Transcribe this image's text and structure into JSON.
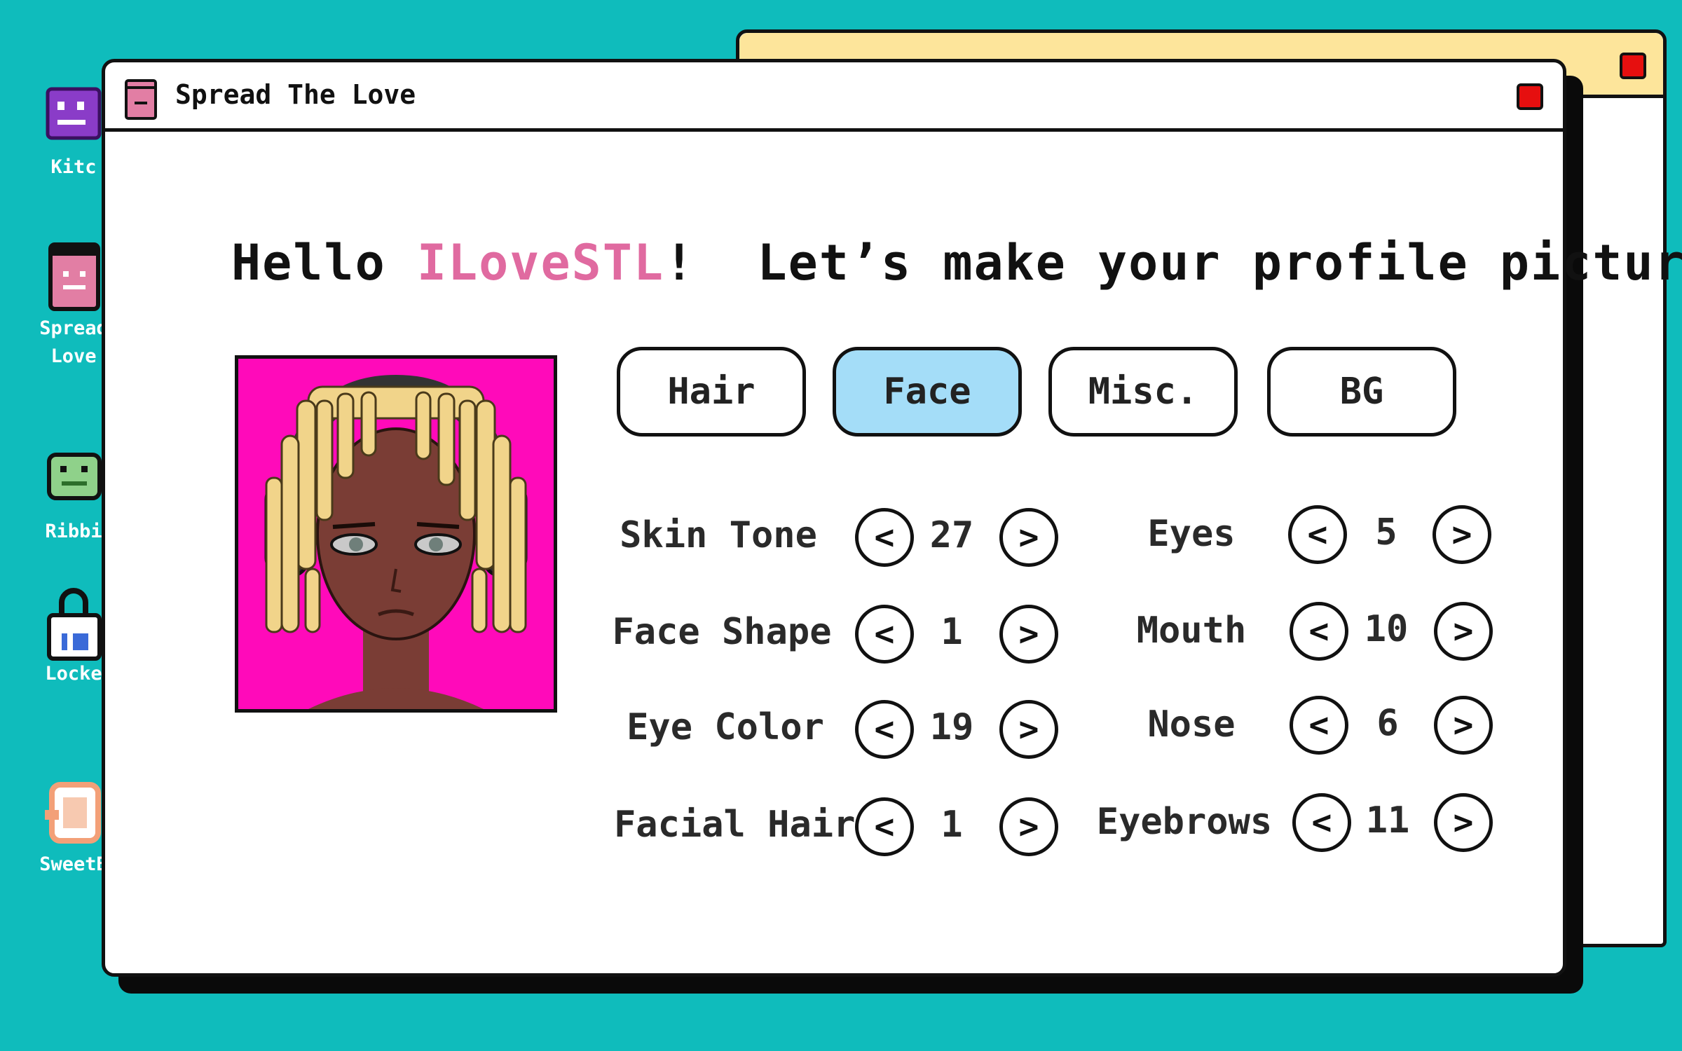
{
  "desktop": {
    "icons": [
      {
        "label": "Kitc",
        "icon": "kitchen-face-icon",
        "color": "#8a3cc8"
      },
      {
        "label": "Spread\nLove",
        "icon": "spread-love-app-icon",
        "color": "#e27ea4"
      },
      {
        "label": "Ribbi",
        "icon": "frog-icon",
        "color": "#8fd18a"
      },
      {
        "label": "Locke",
        "icon": "lock-icon",
        "color": "#ffffff"
      },
      {
        "label": "SweetB",
        "icon": "sweet-bakery-icon",
        "color": "#f3a078"
      }
    ]
  },
  "window": {
    "title": "Spread The Love"
  },
  "greeting": {
    "prefix": "Hello ",
    "username": "ILoveSTL",
    "suffix": "!  Let’s make your profile picture."
  },
  "tabs": [
    {
      "label": "Hair",
      "active": false
    },
    {
      "label": "Face",
      "active": true
    },
    {
      "label": "Misc.",
      "active": false
    },
    {
      "label": "BG",
      "active": false
    }
  ],
  "face_options": {
    "left": [
      {
        "label": "Skin Tone",
        "value": "27"
      },
      {
        "label": "Face Shape",
        "value": "1"
      },
      {
        "label": "Eye Color",
        "value": "19"
      },
      {
        "label": "Facial Hair",
        "value": "1"
      }
    ],
    "right": [
      {
        "label": "Eyes",
        "value": "5"
      },
      {
        "label": "Mouth",
        "value": "10"
      },
      {
        "label": "Nose",
        "value": "6"
      },
      {
        "label": "Eyebrows",
        "value": "11"
      }
    ]
  },
  "arrows": {
    "prev": "<",
    "next": ">"
  },
  "colors": {
    "desktop_bg": "#0fbcbc",
    "active_tab": "#a4ddf8",
    "username": "#e06aa0",
    "avatar_bg": "#ff0aba",
    "close_button": "#e60f0f",
    "back_window_titlebar": "#fde59b"
  }
}
